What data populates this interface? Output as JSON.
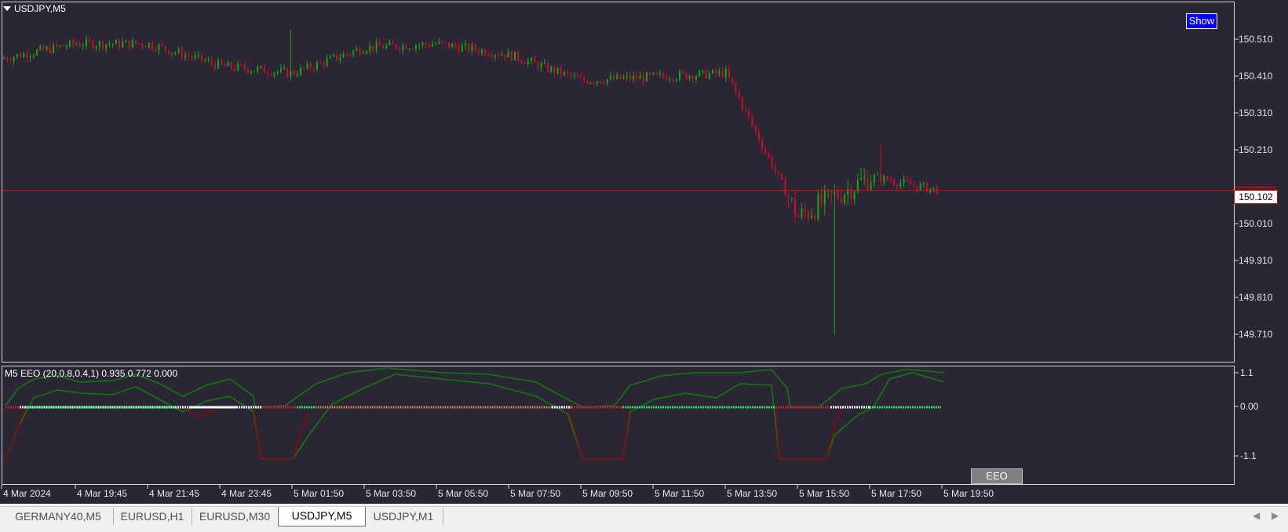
{
  "main_chart": {
    "title": "USDJPY,M5",
    "show_button": "Show",
    "current_price": "150.102",
    "price_ticks": [
      "150.510",
      "150.410",
      "150.310",
      "150.210",
      "150.102",
      "150.010",
      "149.910",
      "149.810",
      "149.710"
    ],
    "price_levels": [
      150.51,
      150.41,
      150.31,
      150.21,
      150.01,
      149.91,
      149.81,
      149.71
    ],
    "price_labels": [
      "150.510",
      "150.410",
      "150.310",
      "150.210",
      "150.010",
      "149.910",
      "149.810",
      "149.710"
    ],
    "colors": {
      "background": "#2a2633",
      "bull": "#15a815",
      "bear": "#c8102e",
      "price_line": "#c81414"
    }
  },
  "indicator": {
    "title": "M5 EEO  (20,0.8,0.4,1) 0.935 0.772 0.000",
    "levels": [
      "1.1",
      "0.00",
      "-1.1"
    ],
    "eeo_button": "EEO",
    "colors": {
      "upper": "#0f7a0f",
      "lower": "#8a0a0a",
      "zero_bull": "#22dd66",
      "zero_bear": "#c01e2e",
      "zero_neutral": "#ffffff"
    }
  },
  "time_axis": [
    "4 Mar 2024",
    "4 Mar 19:45",
    "4 Mar 21:45",
    "4 Mar 23:45",
    "5 Mar 01:50",
    "5 Mar 03:50",
    "5 Mar 05:50",
    "5 Mar 07:50",
    "5 Mar 09:50",
    "5 Mar 11:50",
    "5 Mar 13:50",
    "5 Mar 15:50",
    "5 Mar 17:50",
    "5 Mar 19:50"
  ],
  "tabs": [
    {
      "label": "GERMANY40,M5",
      "active": false
    },
    {
      "label": "EURUSD,H1",
      "active": false
    },
    {
      "label": "EURUSD,M30",
      "active": false
    },
    {
      "label": "USDJPY,M5",
      "active": true
    },
    {
      "label": "USDJPY,M1",
      "active": false
    }
  ],
  "chart_data": {
    "type": "candlestick",
    "symbol": "USDJPY",
    "timeframe": "M5",
    "x_range": [
      "4 Mar 2024",
      "5 Mar 19:50"
    ],
    "y_range": [
      149.7,
      150.54
    ],
    "last_price": 150.102,
    "close_path": [
      {
        "time": "4 Mar 2024",
        "price": 150.46
      },
      {
        "time": "4 Mar 19:45",
        "price": 150.5
      },
      {
        "time": "4 Mar 21:45",
        "price": 150.5
      },
      {
        "time": "4 Mar 23:45",
        "price": 150.44
      },
      {
        "time": "5 Mar 01:50",
        "price": 150.42
      },
      {
        "time": "5 Mar 03:50",
        "price": 150.49
      },
      {
        "time": "5 Mar 05:50",
        "price": 150.5
      },
      {
        "time": "5 Mar 07:50",
        "price": 150.47
      },
      {
        "time": "5 Mar 09:50",
        "price": 150.4
      },
      {
        "time": "5 Mar 11:50",
        "price": 150.41
      },
      {
        "time": "5 Mar 13:50",
        "price": 150.42
      },
      {
        "time": "5 Mar 15:50",
        "price": 150.03
      },
      {
        "time": "5 Mar 17:50",
        "price": 150.14
      },
      {
        "time": "5 Mar 19:50",
        "price": 150.1
      }
    ],
    "extremes": {
      "low": 149.71,
      "high": 150.54
    },
    "indicator": {
      "name": "EEO",
      "params": "(20,0.8,0.4,1)",
      "values": [
        0.935,
        0.772,
        0.0
      ],
      "y_range": [
        -1.1,
        1.1
      ]
    }
  }
}
